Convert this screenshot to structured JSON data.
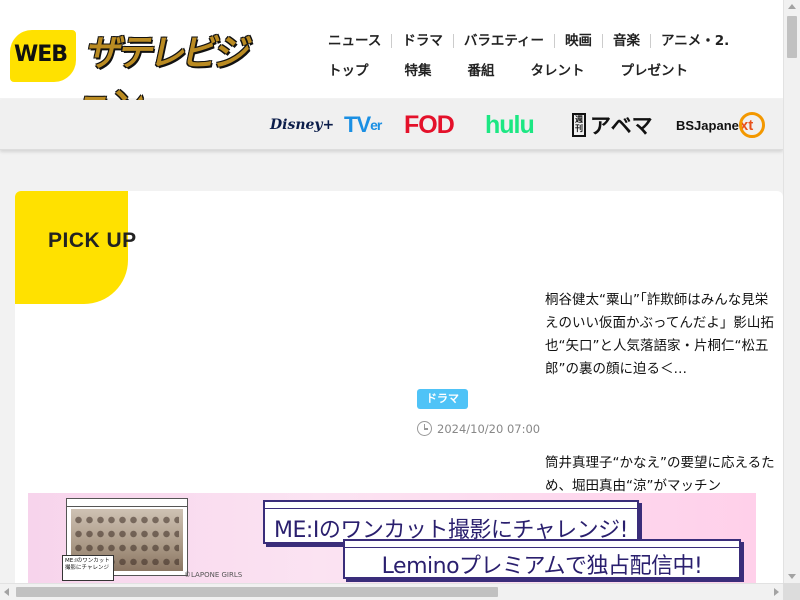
{
  "header": {
    "logo_web": "WEB",
    "logo_name": "ザテレビジョン",
    "nav_row1": [
      "ニュース",
      "ドラマ",
      "バラエティー",
      "映画",
      "音楽",
      "アニメ・2."
    ],
    "nav_row2": [
      "トップ",
      "特集",
      "番組",
      "タレント",
      "プレゼント"
    ]
  },
  "streaming": {
    "disney": "Disney+",
    "tver_main": "TV",
    "tver_sub": "er",
    "fod": "FOD",
    "hulu": "hulu",
    "abema_box": "週刊",
    "abema": "アベマ",
    "bsj": "BSJapane",
    "bsj_next": "xt"
  },
  "pickup": {
    "title": "PICK UP",
    "article1": {
      "text": "桐谷健太“粟山”「詐欺師はみんな見栄えのいい仮面かぶってんだよ」影山拓也“矢口”と人気落語家・片桐仁“松五郎”の裏の顔に迫る＜…",
      "tag": "ドラマ",
      "date": "2024/10/20 07:00"
    },
    "article2": {
      "text": "筒井真理子“かなえ”の要望に応えるため、堀田真由“涼”がマッチン"
    }
  },
  "ad": {
    "headline": "ME:Iのワンカット撮影にチャレンジ!",
    "subline": "Leminoプレミアムで独占配信中!",
    "small_label": "ME:Iのワンカット撮影にチャレンジ",
    "credit": "©LAPONE GIRLS",
    "close": "×"
  },
  "colors": {
    "accent_yellow": "#ffe100",
    "tag_blue": "#4fc3f7",
    "ad_text": "#2a1f6e"
  }
}
